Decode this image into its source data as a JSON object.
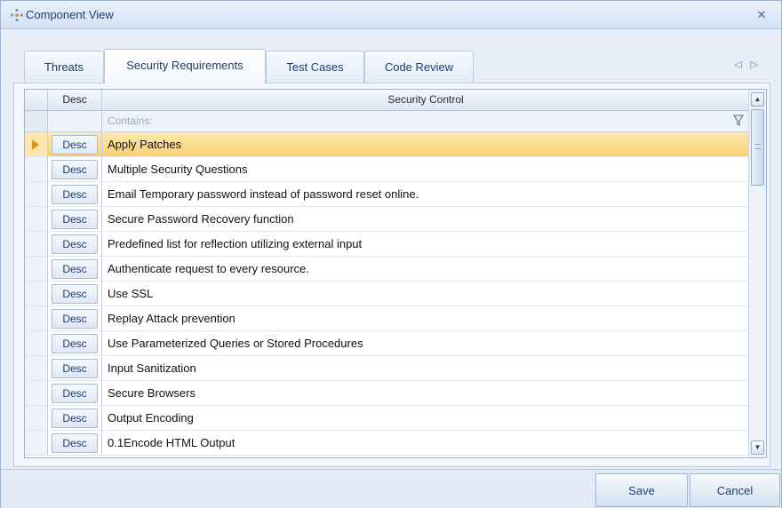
{
  "window": {
    "title": "Component View",
    "title_icon": "component-icon",
    "close_icon": "close-icon"
  },
  "tabs": [
    {
      "label": "Threats",
      "active": false
    },
    {
      "label": "Security Requirements",
      "active": true
    },
    {
      "label": "Test Cases",
      "active": false
    },
    {
      "label": "Code Review",
      "active": false
    }
  ],
  "grid": {
    "columns": {
      "desc": "Desc",
      "control": "Security Control"
    },
    "filter": {
      "placeholder": "Contains:",
      "icon": "filter-icon"
    },
    "button_label": "Desc",
    "selected_index": 0,
    "rows": [
      "Apply Patches",
      "Multiple Security Questions",
      "Email Temporary password instead of password reset online.",
      "Secure Password Recovery function",
      "Predefined list for reflection utilizing external input",
      "Authenticate request to every resource.",
      "Use SSL",
      "Replay Attack prevention",
      "Use Parameterized Queries or Stored Procedures",
      "Input Sanitization",
      "Secure Browsers",
      "Output Encoding",
      "0.1Encode HTML Output"
    ]
  },
  "footer": {
    "save_label": "Save",
    "cancel_label": "Cancel"
  },
  "colors": {
    "accent": "#f9cf74",
    "frame": "#e7eef8",
    "border": "#9fb4d0"
  }
}
